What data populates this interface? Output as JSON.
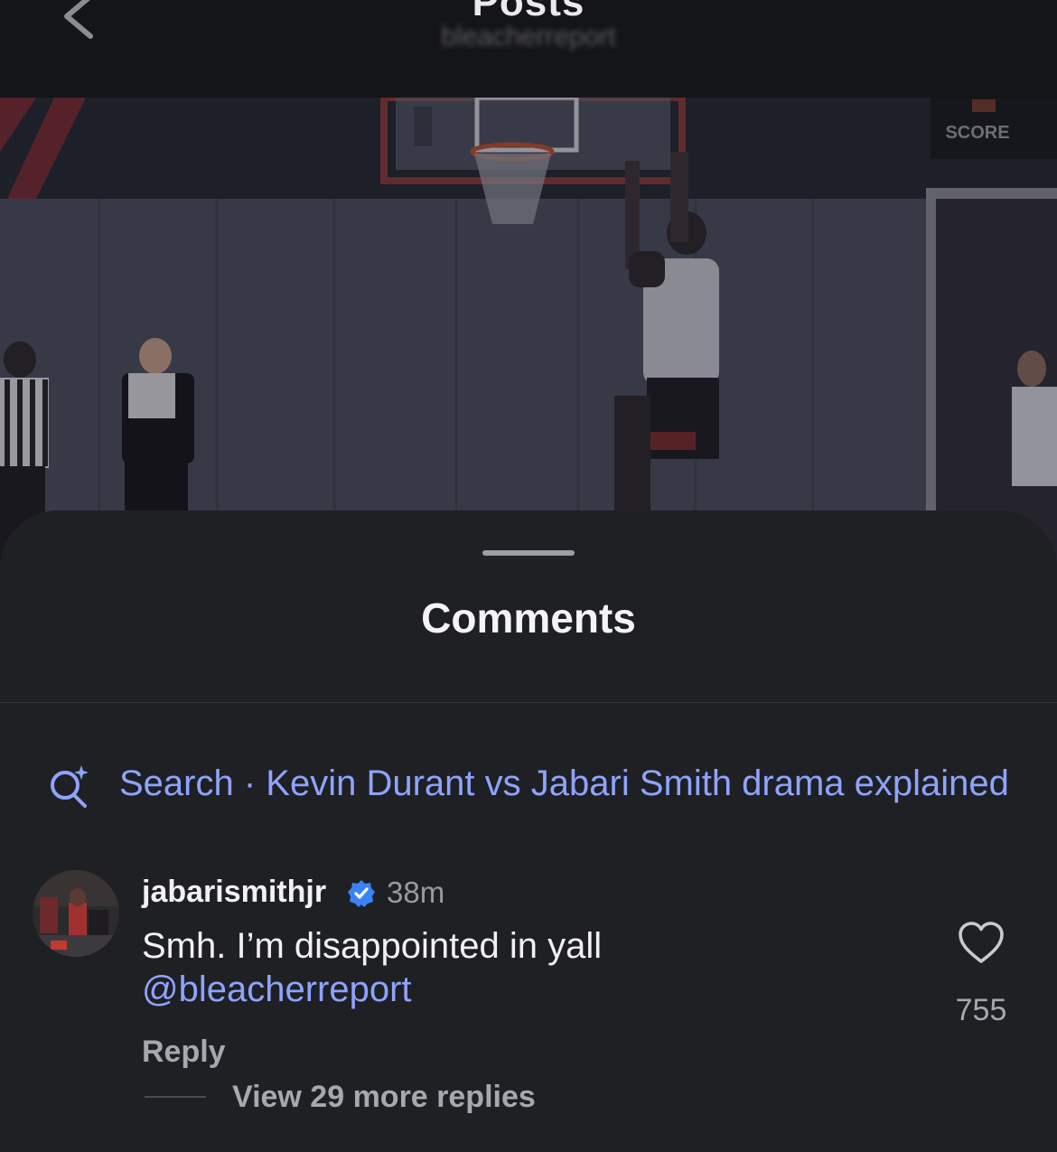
{
  "topbar": {
    "title": "Posts",
    "subtitle": "bleacherreport"
  },
  "video": {
    "scoreboard_label": "SCORE"
  },
  "sheet": {
    "title": "Comments",
    "search": {
      "prefix": "Search",
      "separator": " · ",
      "query": "Kevin Durant vs Jabari Smith drama explained"
    }
  },
  "comment": {
    "username": "jabarismithjr",
    "verified": true,
    "time": "38m",
    "text": "Smh. I’m disappointed in yall",
    "mention": "@bleacherreport",
    "likes": "755",
    "reply_label": "Reply",
    "view_replies_label": "View 29 more replies"
  },
  "colors": {
    "accent_link": "#8ea4ff",
    "sheet_bg": "#1f2024",
    "verified_badge": "#3b82f6"
  },
  "icons": {
    "back": "chevron-left-icon",
    "search": "search-sparkle-icon",
    "verified": "verified-badge-icon",
    "like": "heart-outline-icon"
  }
}
